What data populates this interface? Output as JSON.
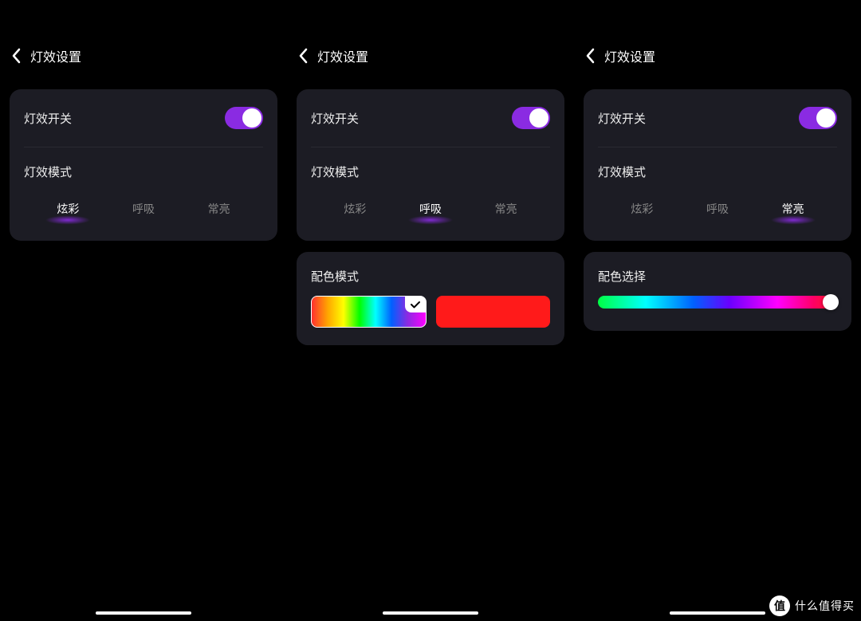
{
  "screens": [
    {
      "header_title": "灯效设置",
      "toggle_label": "灯效开关",
      "toggle_on": true,
      "mode_label": "灯效模式",
      "modes": [
        "炫彩",
        "呼吸",
        "常亮"
      ],
      "active_mode_index": 0
    },
    {
      "header_title": "灯效设置",
      "toggle_label": "灯效开关",
      "toggle_on": true,
      "mode_label": "灯效模式",
      "modes": [
        "炫彩",
        "呼吸",
        "常亮"
      ],
      "active_mode_index": 1,
      "color_mode_label": "配色模式",
      "swatches": [
        {
          "type": "rainbow",
          "selected": true
        },
        {
          "type": "solid",
          "color": "#ff1a1a",
          "selected": false
        }
      ]
    },
    {
      "header_title": "灯效设置",
      "toggle_label": "灯效开关",
      "toggle_on": true,
      "mode_label": "灯效模式",
      "modes": [
        "炫彩",
        "呼吸",
        "常亮"
      ],
      "active_mode_index": 2,
      "color_select_label": "配色选择",
      "slider_position": 1.0
    }
  ],
  "watermark": {
    "badge": "值",
    "text": "什么值得买"
  }
}
